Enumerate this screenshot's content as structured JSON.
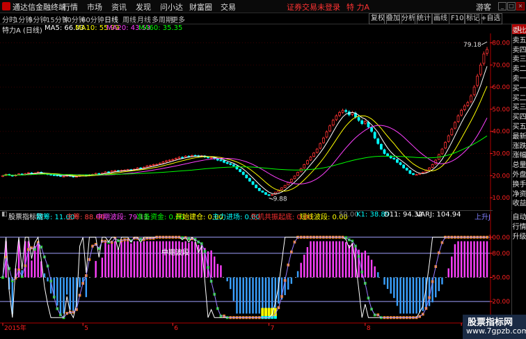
{
  "titlebar": {
    "app_name": "通达信金融终端",
    "menus": [
      "行情",
      "市场",
      "资讯",
      "发现",
      "问小达",
      "财富圈",
      "交易"
    ],
    "warning": "证券交易未登录",
    "stock": "特 力A",
    "guest": "游客"
  },
  "periods": {
    "items": [
      "分时",
      "1分钟",
      "5分钟",
      "15分钟",
      "30分钟",
      "60分钟",
      "日线",
      "周线",
      "月线",
      "多周期",
      "更多"
    ],
    "active_index": 6
  },
  "toolbar": [
    "复权",
    "叠加",
    "分析",
    "统计",
    "画线",
    "F10",
    "标记",
    "+自选"
  ],
  "main_header": {
    "name": "特力A (日线)",
    "ma": [
      {
        "label": "MA5: 66.03",
        "color": "#ffffff"
      },
      {
        "label": "MA10: 55.99",
        "color": "#ffff00"
      },
      {
        "label": "MA20: 43.53",
        "color": "#ff40ff"
      },
      {
        "label": "MA60: 35.35",
        "color": "#00ff00"
      }
    ]
  },
  "price_axis": {
    "ticks": [
      "80.00",
      "70.00",
      "60.00",
      "50.00",
      "40.00",
      "30.00",
      "20.00",
      "10.00"
    ],
    "values": [
      80,
      70,
      60,
      50,
      40,
      30,
      20,
      10
    ],
    "range": [
      5,
      83
    ],
    "high_label": "79.18",
    "low_label": "9.88",
    "color": "#ff2020"
  },
  "indicator_header": {
    "name": "股票指标网",
    "items": [
      {
        "label": "散筹: 11.00",
        "color": "#00ffff"
      },
      {
        "label": "主筹: 88.00",
        "color": "#ff4040"
      },
      {
        "label": "中期波段: 79.11",
        "color": "#ff40ff"
      },
      {
        "label": "准备资金: 0.00",
        "color": "#00ff00"
      },
      {
        "label": "开始建仓: 0.00",
        "color": "#ffff00"
      },
      {
        "label": "主力进场: 0.00",
        "color": "#00ffff"
      },
      {
        "label": "先机共振起底: 0.00",
        "color": "#ff3030"
      },
      {
        "label": "短线波段: 0.00",
        "color": "#ffff00"
      },
      {
        "label": "50.00",
        "color": "#808080"
      },
      {
        "label": "K1: 38.89",
        "color": "#00ffff"
      },
      {
        "label": "D11: 94.32",
        "color": "#ffffff"
      },
      {
        "label": "VARJ: 104.94",
        "color": "#ffffff"
      },
      {
        "label": "上升J",
        "color": "#8080ff"
      }
    ],
    "annotation": "中期波段"
  },
  "indicator_axis": {
    "ticks": [
      "100.00",
      "80.00",
      "50.00",
      "20.00"
    ],
    "values": [
      100,
      80,
      50,
      20
    ],
    "range": [
      -5,
      118
    ]
  },
  "date_axis": {
    "labels": [
      {
        "text": "2015年",
        "idx": 0
      },
      {
        "text": "5",
        "idx": 25
      },
      {
        "text": "6",
        "idx": 53
      },
      {
        "text": "7",
        "idx": 83
      },
      {
        "text": "8",
        "idx": 113
      },
      {
        "text": "9",
        "idx": 143
      },
      {
        "text": "10",
        "idx": 167
      },
      {
        "text": "1",
        "idx": 180
      }
    ]
  },
  "sidebar_top": [
    "委比",
    "卖五",
    "卖四",
    "卖三",
    "卖二",
    "卖一",
    "买一",
    "买二",
    "买三",
    "买四",
    "买五",
    "最新",
    "涨跌",
    "涨幅",
    "总量",
    "外盘",
    "换手",
    "净资",
    "收益"
  ],
  "sidebar_bottom": [
    "自动",
    "行情",
    "升级"
  ],
  "sidebar_top_label": "L",
  "watermark": {
    "line1": "股票指标网",
    "line2": "www.7gpzb.com"
  },
  "colors": {
    "up": "#ff3333",
    "down": "#00ffff",
    "ma5": "#ffffff",
    "ma10": "#ffff00",
    "ma20": "#ff40ff",
    "ma60": "#00ff00"
  },
  "chart_data": {
    "type": "candlestick",
    "close": [
      20,
      20.6,
      20.2,
      19.8,
      20.3,
      20.8,
      20.4,
      20.9,
      21.3,
      20.9,
      21.2,
      21.6,
      21.1,
      20.8,
      20.6,
      20.3,
      20.2,
      20.0,
      19.7,
      19.7,
      20.2,
      19.8,
      19.4,
      19.6,
      20.2,
      20.3,
      19.9,
      20.4,
      20.6,
      21.0,
      20.6,
      21.1,
      21.7,
      21.6,
      22.1,
      22.3,
      22.0,
      22.4,
      22.5,
      22.7,
      22.6,
      22.9,
      23.5,
      23.4,
      23.8,
      24.4,
      24.6,
      25.0,
      25.1,
      25.6,
      26.2,
      26.7,
      27.0,
      27.3,
      27.8,
      28.3,
      28.2,
      28.8,
      28.6,
      29.1,
      29.0,
      28.7,
      28.9,
      28.4,
      28.1,
      28.2,
      27.6,
      27.0,
      26.9,
      26.0,
      25.5,
      25.0,
      24.4,
      23.0,
      21.8,
      20.5,
      19.0,
      17.5,
      16.0,
      14.5,
      13.2,
      12.5,
      11.5,
      11.0,
      11.4,
      12.5,
      13.5,
      14.5,
      15.6,
      17.0,
      18.4,
      19.8,
      21.5,
      23.2,
      25.0,
      26.8,
      28.4,
      30.2,
      32.0,
      34.5,
      37.0,
      39.8,
      42.5,
      45.0,
      47.0,
      48.5,
      49.5,
      49.0,
      47.5,
      48.5,
      46.5,
      45.0,
      43.5,
      44.5,
      42.0,
      40.0,
      37.0,
      34.5,
      32.0,
      30.0,
      29.0,
      28.0,
      27.5,
      26.0,
      25.0,
      23.5,
      22.5,
      21.0,
      20.5,
      20.5,
      21.0,
      21.5,
      22.5,
      23.5,
      25.0,
      27.0,
      29.5,
      32.0,
      35.0,
      38.0,
      41.0,
      44.0,
      47.0,
      49.5,
      51.5,
      53.0,
      56.0,
      60.0,
      65.0,
      70.0,
      75.0,
      77.0
    ],
    "ma5": 66.03,
    "ma10": 55.99,
    "ma20": 43.53,
    "ma60": 35.35,
    "high": 79.18,
    "low": 9.88,
    "oscillator": {
      "hist_range": [
        0,
        100
      ],
      "reference_lines": [
        100,
        80,
        50,
        20
      ]
    }
  }
}
